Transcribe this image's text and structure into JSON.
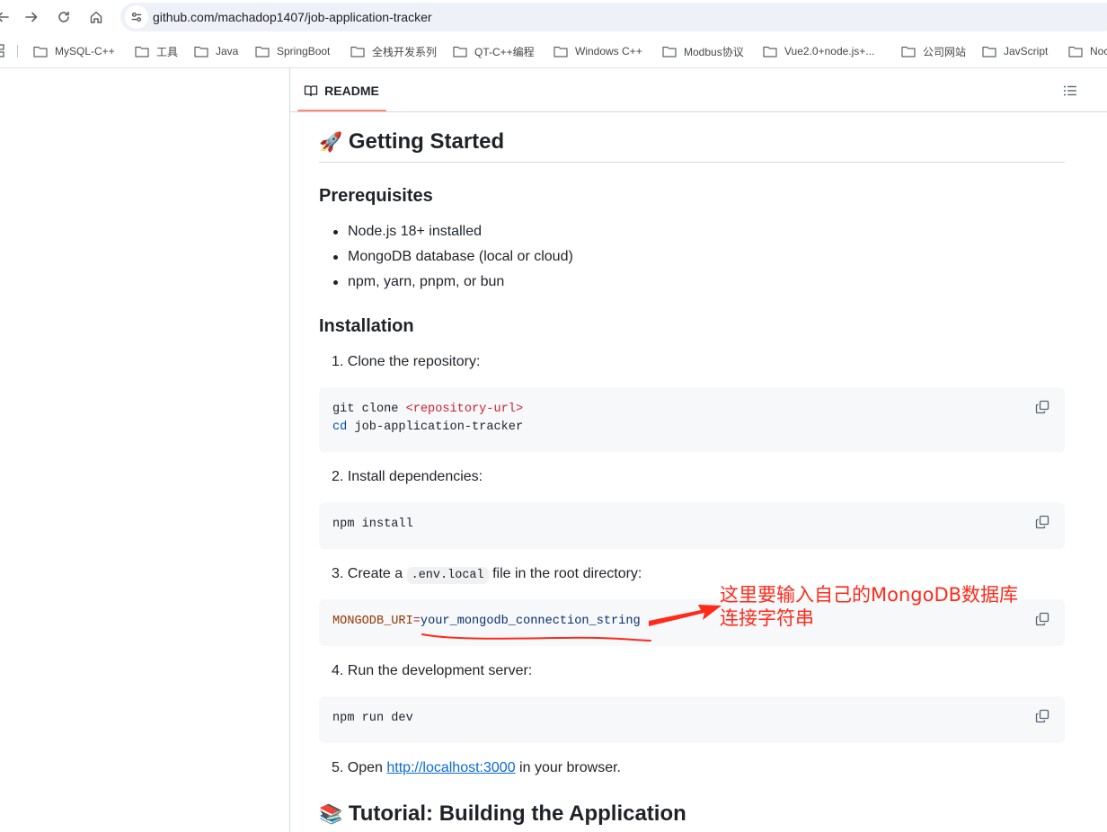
{
  "browser": {
    "url": "github.com/machadop1407/job-application-tracker",
    "bookmarks": [
      "MySQL-C++",
      "工具",
      "Java",
      "SpringBoot",
      "全栈开发系列",
      "QT-C++编程",
      "Windows C++",
      "Modbus协议",
      "Vue2.0+node.js+...",
      "公司网站",
      "JavScript",
      "Noc"
    ]
  },
  "readme": {
    "tab_label": "README",
    "getting_started": {
      "emoji": "🚀",
      "title": "Getting Started"
    },
    "prerequisites": {
      "title": "Prerequisites",
      "items": [
        "Node.js 18+ installed",
        "MongoDB database (local or cloud)",
        "npm, yarn, pnpm, or bun"
      ]
    },
    "installation": {
      "title": "Installation",
      "step1": "1. Clone the repository:",
      "code1": {
        "line1_cmd": "git clone ",
        "line1_arg": "<repository-url>",
        "line2_kw": "cd",
        "line2_rest": " job-application-tracker"
      },
      "step2": "2. Install dependencies:",
      "code2": "npm install",
      "step3_prefix": "3. Create a ",
      "step3_code": ".env.local",
      "step3_suffix": " file in the root directory:",
      "code3": {
        "var": "MONGODB_URI",
        "op": "=",
        "value": "your_mongodb_connection_string"
      },
      "step4": "4. Run the development server:",
      "code4": "npm run dev",
      "step5_prefix": "5. Open ",
      "step5_link": "http://localhost:3000",
      "step5_suffix": " in your browser."
    },
    "tutorial": {
      "emoji": "📚",
      "title": "Tutorial: Building the Application"
    }
  },
  "annotation": {
    "line1": "这里要输入自己的MongoDB数据库",
    "line2": "连接字符串",
    "color": "#ff2a1a"
  }
}
